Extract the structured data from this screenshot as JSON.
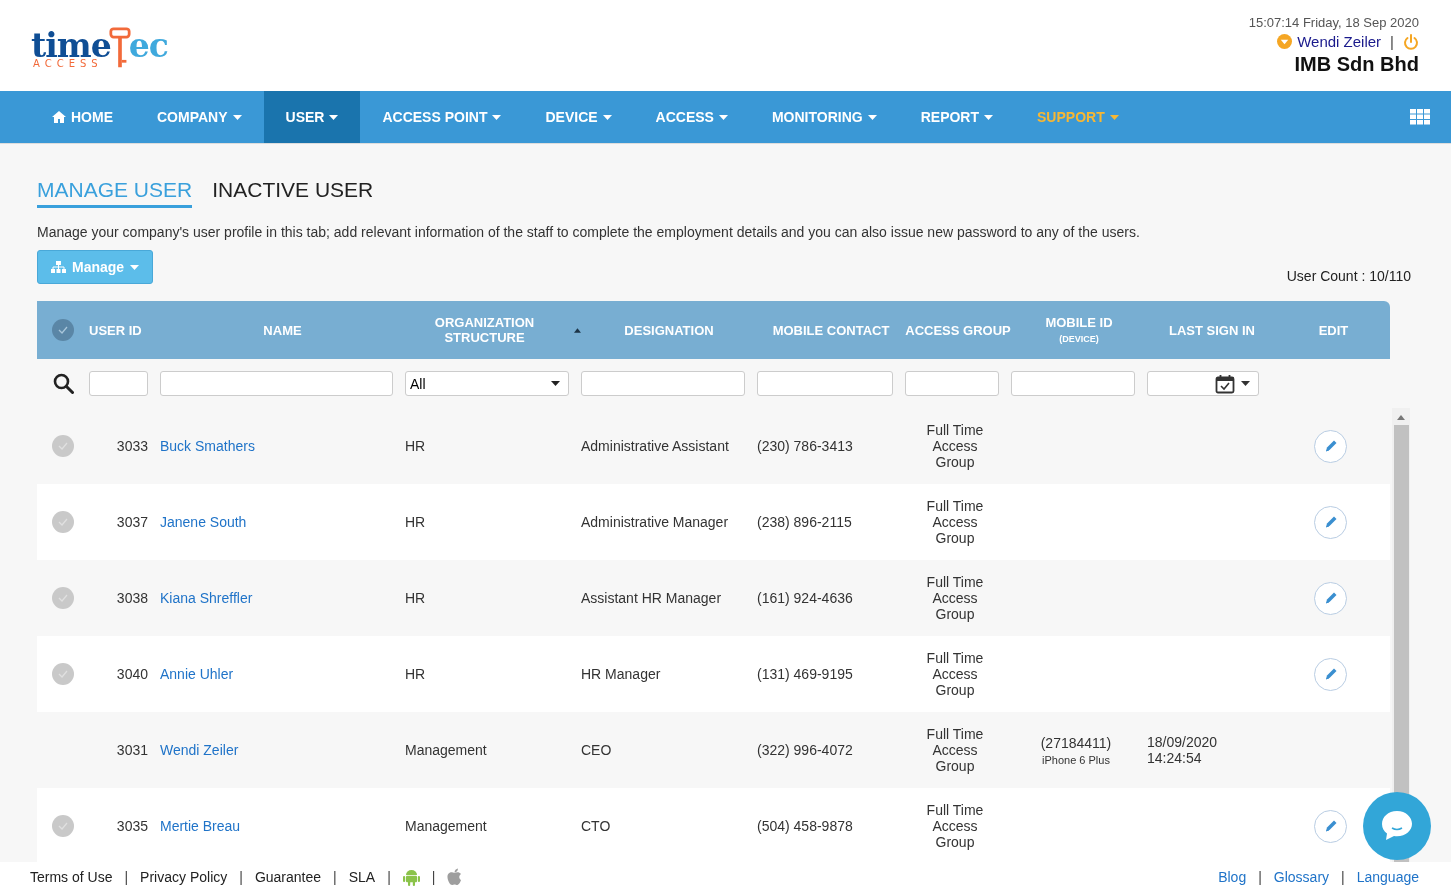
{
  "header": {
    "logo": {
      "word_a": "time",
      "word_b": "ec",
      "tagline": "ACCESS"
    },
    "datetime": "15:07:14 Friday, 18 Sep 2020",
    "user": "Wendi Zeiler",
    "separator": "|",
    "company": "IMB Sdn Bhd"
  },
  "nav": [
    {
      "label": "HOME",
      "kind": "home",
      "selected": false,
      "highlighted": false
    },
    {
      "label": "COMPANY",
      "kind": "dropdown",
      "selected": false,
      "highlighted": false
    },
    {
      "label": "USER",
      "kind": "dropdown",
      "selected": true,
      "highlighted": false
    },
    {
      "label": "ACCESS POINT",
      "kind": "dropdown",
      "selected": false,
      "highlighted": false
    },
    {
      "label": "DEVICE",
      "kind": "dropdown",
      "selected": false,
      "highlighted": false
    },
    {
      "label": "ACCESS",
      "kind": "dropdown",
      "selected": false,
      "highlighted": false
    },
    {
      "label": "MONITORING",
      "kind": "dropdown",
      "selected": false,
      "highlighted": false
    },
    {
      "label": "REPORT",
      "kind": "dropdown",
      "selected": false,
      "highlighted": false
    },
    {
      "label": "SUPPORT",
      "kind": "dropdown",
      "selected": false,
      "highlighted": true
    }
  ],
  "tabs": [
    {
      "label": "MANAGE USER",
      "selected": true
    },
    {
      "label": "INACTIVE USER",
      "selected": false
    }
  ],
  "description": "Manage your company's user profile in this tab; add relevant information of the staff to complete the employment details and you can also issue new password to any of the users.",
  "manage_button": "Manage",
  "user_count": "User Count : 10/110",
  "table": {
    "select_all_checked": false,
    "columns": [
      {
        "label": "USER ID",
        "kind": "text"
      },
      {
        "label": "NAME",
        "kind": "text"
      },
      {
        "label": "ORGANIZATION STRUCTURE",
        "kind": "select",
        "filter_value": "All",
        "sorted": true
      },
      {
        "label": "DESIGNATION",
        "kind": "text"
      },
      {
        "label": "MOBILE CONTACT",
        "kind": "text"
      },
      {
        "label": "ACCESS GROUP",
        "kind": "text"
      },
      {
        "label": "MOBILE ID",
        "sub": "(DEVICE)",
        "kind": "text"
      },
      {
        "label": "LAST SIGN IN",
        "kind": "date"
      },
      {
        "label": "EDIT",
        "kind": "plain"
      }
    ],
    "rows": [
      {
        "has_checkbox": true,
        "checked": false,
        "user_id": "3033",
        "name": "Buck Smathers",
        "org": "HR",
        "designation": "Administrative Assistant",
        "mobile": "(230) 786-3413",
        "access_group": "Full Time Access Group",
        "editable": true
      },
      {
        "has_checkbox": true,
        "checked": false,
        "user_id": "3037",
        "name": "Janene South",
        "org": "HR",
        "designation": "Administrative Manager",
        "mobile": "(238) 896-2115",
        "access_group": "Full Time Access Group",
        "editable": true
      },
      {
        "has_checkbox": true,
        "checked": false,
        "user_id": "3038",
        "name": "Kiana Shreffler",
        "org": "HR",
        "designation": "Assistant HR Manager",
        "mobile": "(161) 924-4636",
        "access_group": "Full Time Access Group",
        "editable": true
      },
      {
        "has_checkbox": true,
        "checked": false,
        "user_id": "3040",
        "name": "Annie Uhler",
        "org": "HR",
        "designation": "HR Manager",
        "mobile": "(131) 469-9195",
        "access_group": "Full Time Access Group",
        "editable": true
      },
      {
        "has_checkbox": false,
        "user_id": "3031",
        "name": "Wendi Zeiler",
        "org": "Management",
        "designation": "CEO",
        "mobile": "(322) 996-4072",
        "access_group": "Full Time Access Group",
        "mobile_id": "(27184411)",
        "device": "iPhone 6 Plus",
        "last_sign_in": "18/09/2020 14:24:54",
        "editable": false
      },
      {
        "has_checkbox": true,
        "checked": false,
        "user_id": "3035",
        "name": "Mertie Breau",
        "org": "Management",
        "designation": "CTO",
        "mobile": "(504) 458-9878",
        "access_group": "Full Time Access Group",
        "editable": true
      }
    ]
  },
  "footer": {
    "left": [
      {
        "label": "Terms of Use",
        "kind": "link"
      },
      {
        "label": "Privacy Policy",
        "kind": "link"
      },
      {
        "label": "Guarantee",
        "kind": "link"
      },
      {
        "label": "SLA",
        "kind": "link"
      },
      {
        "kind": "android"
      },
      {
        "kind": "apple"
      }
    ],
    "separator": "|",
    "right": [
      "Blog",
      "Glossary",
      "Language"
    ]
  }
}
